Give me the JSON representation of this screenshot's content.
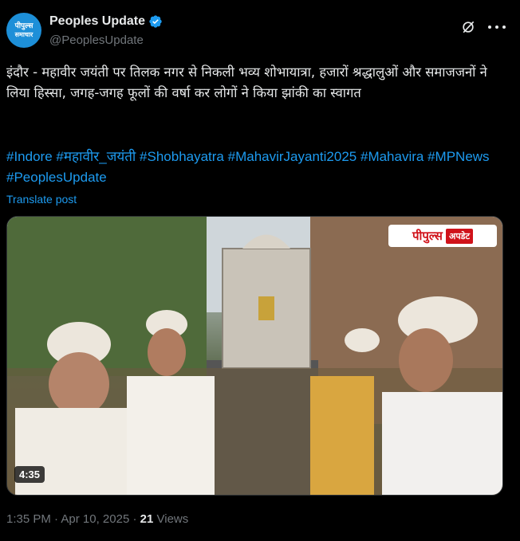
{
  "author": {
    "display_name": "Peoples Update",
    "handle": "@PeoplesUpdate",
    "avatar_text_line1": "पीपुल्स",
    "avatar_text_line2": "समाचार",
    "verified": true
  },
  "post": {
    "text": "इंदौर - महावीर जयंती पर तिलक नगर से निकली भव्य शोभायात्रा, हजारों श्रद्धालुओं और समाजजनों ने लिया हिस्सा, जगह-जगह फूलों की वर्षा कर लोगों ने किया झांकी का स्वागत",
    "hashtags": [
      "#Indore",
      "#महावीर_जयंती",
      "#Shobhayatra",
      "#MahavirJayanti2025",
      "#Mahavira",
      "#MPNews",
      "#PeoplesUpdate"
    ],
    "translate_label": "Translate post"
  },
  "media": {
    "watermark_part1": "पीपुल्स",
    "watermark_part2": "अपडेट",
    "duration": "4:35"
  },
  "meta": {
    "time": "1:35 PM",
    "separator": "·",
    "date": "Apr 10, 2025",
    "views_count": "21",
    "views_label": "Views"
  },
  "colors": {
    "accent": "#1d9bf0",
    "background": "#000000",
    "text": "#e7e9ea",
    "muted": "#71767b"
  },
  "icons": [
    "verified-badge-icon",
    "grok-icon",
    "more-icon"
  ]
}
